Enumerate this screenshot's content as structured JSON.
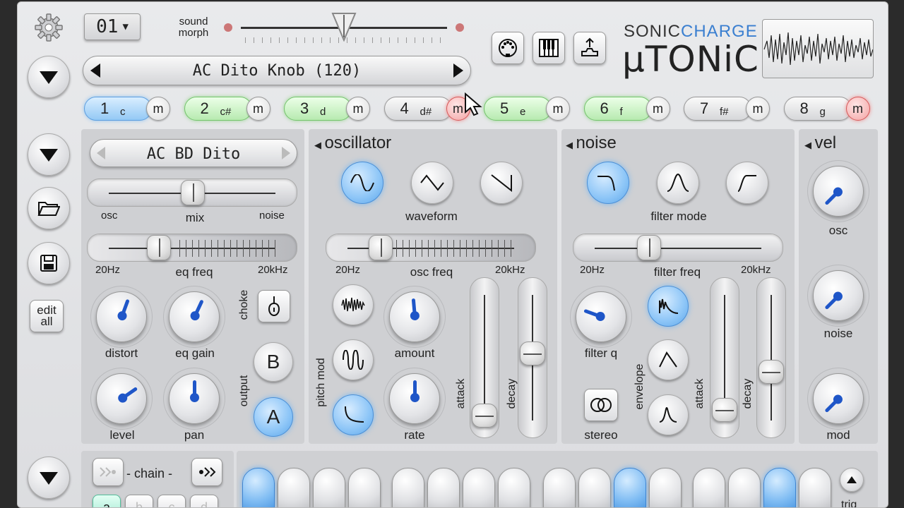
{
  "header": {
    "pattern_select": "01",
    "sound_morph_label": "sound\nmorph",
    "sound_morph_value": 0.5,
    "preset_name": "AC Dito Knob (120)",
    "brand_top_sonic": "SONIC",
    "brand_top_charge": "CHARGE",
    "brand_main": "µTONiC"
  },
  "channels": [
    {
      "num": "1",
      "note": "c",
      "state": "blue"
    },
    {
      "num": "2",
      "note": "c#",
      "state": "green"
    },
    {
      "num": "3",
      "note": "d",
      "state": "green"
    },
    {
      "num": "4",
      "note": "d#",
      "state": "normal"
    },
    {
      "num": "5",
      "note": "e",
      "state": "green"
    },
    {
      "num": "6",
      "note": "f",
      "state": "green"
    },
    {
      "num": "7",
      "note": "f#",
      "state": "normal"
    },
    {
      "num": "8",
      "note": "g",
      "state": "normal"
    }
  ],
  "mute_label": "m",
  "mutes_active": [
    false,
    false,
    false,
    true,
    false,
    false,
    false,
    true
  ],
  "sidebar": {
    "edit_all": "edit\nall"
  },
  "mix": {
    "patch_name": "AC BD Dito",
    "osc": "osc",
    "mix": "mix",
    "noise": "noise",
    "hz_low": "20Hz",
    "eq_freq": "eq freq",
    "hz_high": "20kHz",
    "distort": "distort",
    "eq_gain": "eq gain",
    "level": "level",
    "pan": "pan",
    "choke": "choke",
    "output": "output",
    "out_b": "B",
    "out_a": "A"
  },
  "oscillator": {
    "title": "oscillator",
    "waveform": "waveform",
    "hz_low": "20Hz",
    "osc_freq": "osc freq",
    "hz_high": "20kHz",
    "pitch_mod": "pitch mod",
    "amount": "amount",
    "rate": "rate",
    "attack": "attack",
    "decay": "decay"
  },
  "noise": {
    "title": "noise",
    "filter_mode": "filter mode",
    "hz_low": "20Hz",
    "filter_freq": "filter freq",
    "hz_high": "20kHz",
    "filter_q": "filter q",
    "stereo": "stereo",
    "envelope": "envelope",
    "attack": "attack",
    "decay": "decay"
  },
  "vel": {
    "title": "vel",
    "osc": "osc",
    "noise": "noise",
    "mod": "mod"
  },
  "sequencer": {
    "chain_label": "- chain -",
    "chain_slots": [
      "a",
      "b",
      "c",
      "d"
    ],
    "steps_on": [
      true,
      false,
      false,
      false,
      false,
      false,
      false,
      false,
      false,
      false,
      true,
      false,
      false,
      false,
      true,
      false
    ],
    "trig": "trig"
  }
}
